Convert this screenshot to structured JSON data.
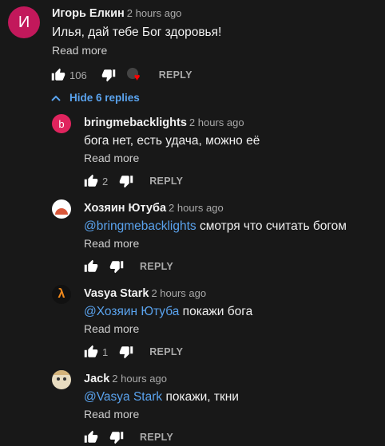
{
  "comment": {
    "author": "Игорь Елкин",
    "time": "2 hours ago",
    "avatar_letter": "И",
    "avatar_color": "#c2185b",
    "text": "Илья, дай тебе Бог здоровья!",
    "read_more": "Read more",
    "likes": "106",
    "reply_label": "REPLY"
  },
  "toggle": {
    "label": "Hide 6 replies"
  },
  "replies": [
    {
      "author": "bringmebacklights",
      "time": "2 hours ago",
      "avatar_letter": "b",
      "avatar_color": "#e0245e",
      "mention": "",
      "text": "бога нет, есть удача, можно её",
      "read_more": "Read more",
      "likes": "2",
      "reply_label": "REPLY"
    },
    {
      "author": "Хозяин Ютуба",
      "time": "2 hours ago",
      "mention": "@bringmebacklights",
      "text": " смотря что считать богом",
      "read_more": "Read more",
      "likes": "",
      "reply_label": "REPLY"
    },
    {
      "author": "Vasya Stark",
      "time": "2 hours ago",
      "mention": "@Хозяин Ютуба",
      "text": " покажи бога",
      "read_more": "Read more",
      "likes": "1",
      "reply_label": "REPLY"
    },
    {
      "author": "Jack",
      "time": "2 hours ago",
      "mention": "@Vasya Stark",
      "text": " покажи, ткни",
      "read_more": "Read more",
      "likes": "",
      "reply_label": "REPLY"
    }
  ],
  "colors": {
    "background": "#181818",
    "link": "#5aa3ee",
    "secondary": "#aaaaaa"
  }
}
